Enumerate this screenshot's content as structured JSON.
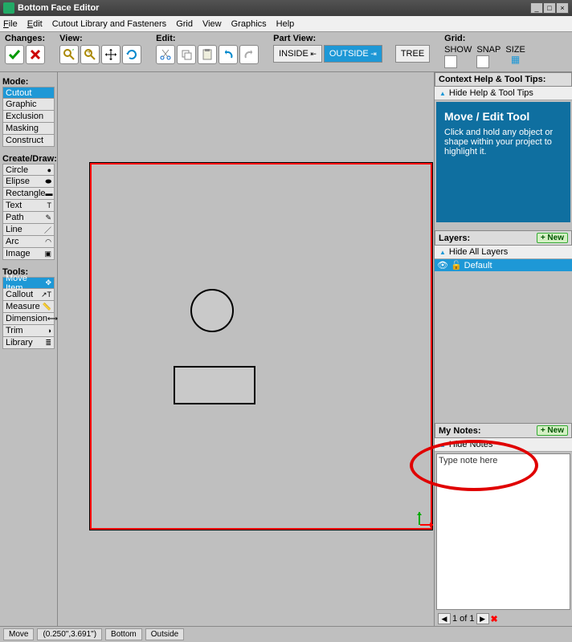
{
  "title": "Bottom Face Editor",
  "menu": {
    "file": "File",
    "edit": "Edit",
    "cutout": "Cutout Library and Fasteners",
    "grid": "Grid",
    "view": "View",
    "graphics": "Graphics",
    "help": "Help"
  },
  "toolbar": {
    "changes": "Changes:",
    "view": "View:",
    "edit": "Edit:",
    "partview": "Part View:",
    "inside": "INSIDE",
    "outside": "OUTSIDE",
    "tree": "TREE",
    "grid": "Grid:",
    "show": "SHOW",
    "snap": "SNAP",
    "size": "SIZE"
  },
  "left": {
    "mode": "Mode:",
    "mode_items": [
      "Cutout",
      "Graphic",
      "Exclusion",
      "Masking",
      "Construct"
    ],
    "create": "Create/Draw:",
    "create_items": [
      "Circle",
      "Elipse",
      "Rectangle",
      "Text",
      "Path",
      "Line",
      "Arc",
      "Image"
    ],
    "tools": "Tools:",
    "tool_items": [
      "Move Item",
      "Callout",
      "Measure",
      "Dimension",
      "Trim",
      "Library"
    ]
  },
  "right": {
    "help_header": "Context Help & Tool Tips:",
    "hide_help": "Hide Help & Tool Tips",
    "help_title": "Move / Edit Tool",
    "help_body": "Click and hold any object or shape within your project to highlight it.",
    "layers": "Layers:",
    "hide_layers": "Hide All Layers",
    "layer_default": "Default",
    "new": "+ New",
    "notes": "My Notes:",
    "hide_notes": "Hide Notes",
    "note_placeholder": "Type note here",
    "page": "1 of 1"
  },
  "status": {
    "move": "Move",
    "coords": "(0.250\",3.691\")",
    "bottom": "Bottom",
    "outside": "Outside"
  }
}
